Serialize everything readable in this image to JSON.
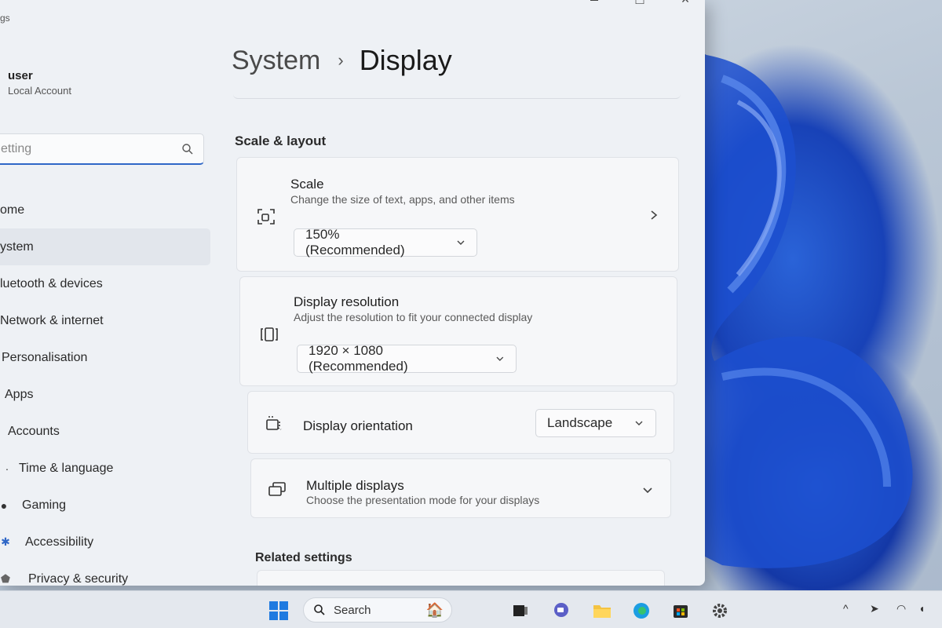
{
  "window": {
    "title_fragment": "gs"
  },
  "sidebar": {
    "user_name": "user",
    "user_account": "Local Account",
    "search_value": "etting",
    "items": [
      {
        "label": "ome",
        "icon": "home-icon"
      },
      {
        "label": "ystem",
        "icon": "system-icon",
        "active": true
      },
      {
        "label": "luetooth & devices",
        "icon": "bluetooth-icon"
      },
      {
        "label": "Network & internet",
        "icon": "network-icon"
      },
      {
        "label": "Personalisation",
        "icon": "brush-icon"
      },
      {
        "label": "Apps",
        "icon": "apps-icon"
      },
      {
        "label": "Accounts",
        "icon": "accounts-icon"
      },
      {
        "label": "Time & language",
        "icon": "clock-icon"
      },
      {
        "label": "Gaming",
        "icon": "gaming-icon"
      },
      {
        "label": "Accessibility",
        "icon": "accessibility-icon"
      },
      {
        "label": "Privacy & security",
        "icon": "shield-icon"
      }
    ]
  },
  "main": {
    "breadcrumb_parent": "System",
    "breadcrumb_separator": "›",
    "breadcrumb_current": "Display",
    "section_scale_layout": "Scale & layout",
    "scale": {
      "title": "Scale",
      "description": "Change the size of text, apps, and other items",
      "value": "150% (Recommended)"
    },
    "resolution": {
      "title": "Display resolution",
      "description": "Adjust the resolution to fit your connected display",
      "value": "1920 × 1080 (Recommended)"
    },
    "orientation": {
      "title": "Display orientation",
      "value": "Landscape"
    },
    "multiple_displays": {
      "title": "Multiple displays",
      "description": "Choose the presentation mode for your displays"
    },
    "section_related": "Related settings"
  },
  "taskbar": {
    "search_label": "Search"
  },
  "colors": {
    "accent": "#2f67c7",
    "window_bg": "#eef1f5",
    "card_bg": "#f6f7f9",
    "wallpaper_blue": "#1842b7"
  }
}
